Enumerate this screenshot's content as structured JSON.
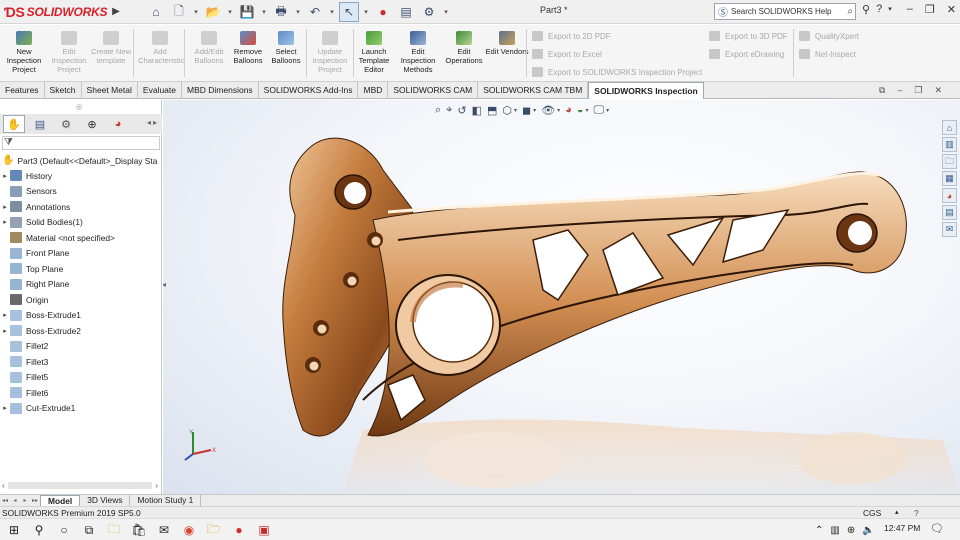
{
  "app": {
    "logo_text": "SOLIDWORKS",
    "document_title": "Part3 *",
    "help_search_placeholder": "Search SOLIDWORKS Help"
  },
  "ribbon": {
    "buttons": [
      {
        "label": "New Inspection Project",
        "enabled": true
      },
      {
        "label": "Edit Inspection Project",
        "enabled": false
      },
      {
        "label": "Create New template",
        "enabled": false
      },
      {
        "label": "Add Characteristic",
        "enabled": false
      },
      {
        "label": "Add/Edit Balloons",
        "enabled": false
      },
      {
        "label": "Remove Balloons",
        "enabled": true
      },
      {
        "label": "Select Balloons",
        "enabled": true
      },
      {
        "label": "Update Inspection Project",
        "enabled": false
      },
      {
        "label": "Launch Template Editor",
        "enabled": true
      },
      {
        "label": "Edit Inspection Methods",
        "enabled": true
      },
      {
        "label": "Edit Operations",
        "enabled": true
      },
      {
        "label": "Edit Vendors",
        "enabled": true
      }
    ],
    "export_links": [
      "Export to 2D PDF",
      "Export to Excel",
      "Export to SOLIDWORKS Inspection Project",
      "Export to 3D PDF",
      "Export eDrawing",
      "QualityXpert",
      "Net-Inspect"
    ]
  },
  "tabs": [
    {
      "label": "Features",
      "active": false
    },
    {
      "label": "Sketch",
      "active": false
    },
    {
      "label": "Sheet Metal",
      "active": false
    },
    {
      "label": "Evaluate",
      "active": false
    },
    {
      "label": "MBD Dimensions",
      "active": false
    },
    {
      "label": "SOLIDWORKS Add-Ins",
      "active": false
    },
    {
      "label": "MBD",
      "active": false
    },
    {
      "label": "SOLIDWORKS CAM",
      "active": false
    },
    {
      "label": "SOLIDWORKS CAM TBM",
      "active": false
    },
    {
      "label": "SOLIDWORKS Inspection",
      "active": true
    }
  ],
  "feature_tree": {
    "root": "Part3  (Default<<Default>_Display Sta",
    "items": [
      {
        "label": "History",
        "expandable": true,
        "icon": "history-icon",
        "color": "#3e6aa8"
      },
      {
        "label": "Sensors",
        "expandable": false,
        "icon": "sensor-icon",
        "color": "#6d86a8"
      },
      {
        "label": "Annotations",
        "expandable": true,
        "icon": "annotations-icon",
        "color": "#5a6f8c"
      },
      {
        "label": "Solid Bodies(1)",
        "expandable": true,
        "icon": "solid-bodies-icon",
        "color": "#7a8aa0"
      },
      {
        "label": "Material <not specified>",
        "expandable": false,
        "icon": "material-icon",
        "color": "#8a6d3b"
      },
      {
        "label": "Front Plane",
        "expandable": false,
        "icon": "plane-icon",
        "color": "#7fa3c9"
      },
      {
        "label": "Top Plane",
        "expandable": false,
        "icon": "plane-icon",
        "color": "#7fa3c9"
      },
      {
        "label": "Right Plane",
        "expandable": false,
        "icon": "plane-icon",
        "color": "#7fa3c9"
      },
      {
        "label": "Origin",
        "expandable": false,
        "icon": "origin-icon",
        "color": "#444444"
      },
      {
        "label": "Boss-Extrude1",
        "expandable": true,
        "icon": "extrude-icon",
        "color": "#8fb2d6"
      },
      {
        "label": "Boss-Extrude2",
        "expandable": true,
        "icon": "extrude-icon",
        "color": "#8fb2d6"
      },
      {
        "label": "Fillet2",
        "expandable": false,
        "icon": "fillet-icon",
        "color": "#8fb2d6"
      },
      {
        "label": "Fillet3",
        "expandable": false,
        "icon": "fillet-icon",
        "color": "#8fb2d6"
      },
      {
        "label": "Fillet5",
        "expandable": false,
        "icon": "fillet-icon",
        "color": "#8fb2d6"
      },
      {
        "label": "Fillet6",
        "expandable": false,
        "icon": "fillet-icon",
        "color": "#8fb2d6"
      },
      {
        "label": "Cut-Extrude1",
        "expandable": true,
        "icon": "cut-extrude-icon",
        "color": "#8fb2d6"
      }
    ]
  },
  "bottom_tabs": [
    {
      "label": "Model",
      "active": true
    },
    {
      "label": "3D Views",
      "active": false
    },
    {
      "label": "Motion Study 1",
      "active": false
    }
  ],
  "status": {
    "text": "SOLIDWORKS Premium 2019 SP5.0",
    "units": "CGS"
  },
  "taskbar": {
    "time": "12:47 PM"
  },
  "colors": {
    "brand": "#d8202a",
    "part_copper": "#b8682e"
  }
}
